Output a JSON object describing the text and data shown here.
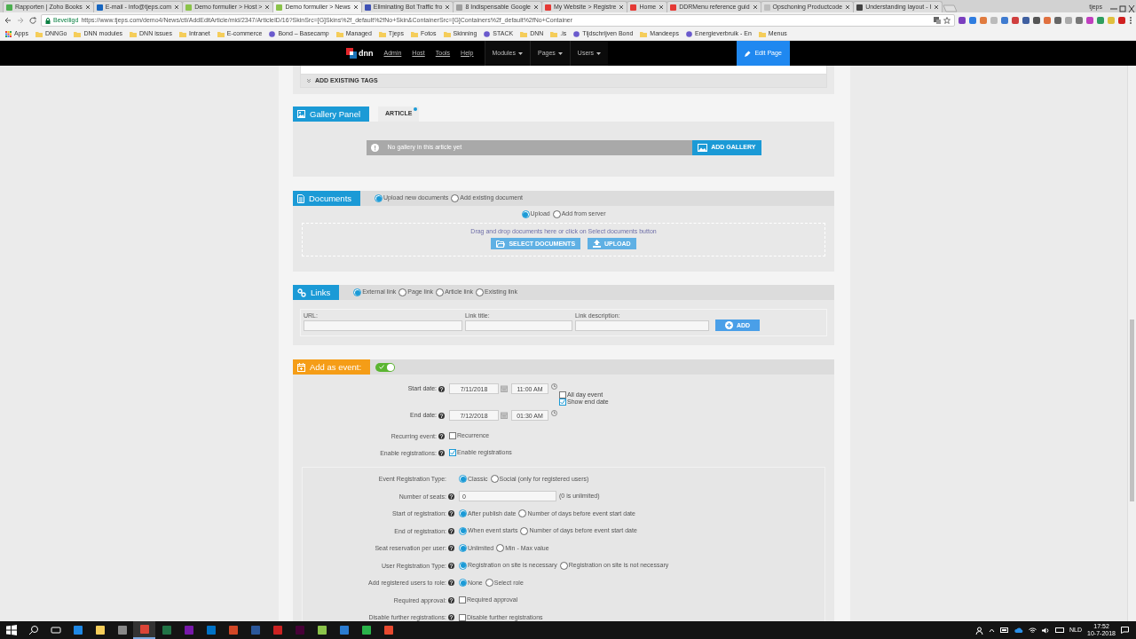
{
  "browser": {
    "tabs": [
      {
        "title": "Rapporten | Zoho Books",
        "selected": false,
        "color": "#4caf50"
      },
      {
        "title": "E-mail - info@tjeps.com",
        "selected": false,
        "color": "#1565c0"
      },
      {
        "title": "Demo formulier > Host >",
        "selected": false,
        "color": "#8bc34a"
      },
      {
        "title": "Demo formulier > News",
        "selected": true,
        "color": "#8bc34a"
      },
      {
        "title": "Eliminating Bot Traffic fro",
        "selected": false,
        "color": "#3f51b5"
      },
      {
        "title": "8 Indispensable Google",
        "selected": false,
        "color": "#9e9e9e"
      },
      {
        "title": "My Website > Registre",
        "selected": false,
        "color": "#e53935"
      },
      {
        "title": "Home",
        "selected": false,
        "color": "#e53935"
      },
      {
        "title": "DDRMenu reference guid",
        "selected": false,
        "color": "#e53935"
      },
      {
        "title": "Opschoning Productcode",
        "selected": false,
        "color": "#bdbdbd"
      },
      {
        "title": "Understanding layout - I",
        "selected": false,
        "color": "#424242"
      }
    ],
    "user": "tjeps",
    "security": "Beveiligd",
    "url": "https://www.tjeps.com/demo4/News/ctl/AddEditArticle/mid/2347/ArticleID/16?SkinSrc=[G]Skins%2f_default%2fNo+Skin&ContainerSrc=[G]Containers%2f_default%2fNo+Container",
    "bookmarks": [
      {
        "label": "Apps",
        "kind": "apps"
      },
      {
        "label": "DNNGo",
        "kind": "folder"
      },
      {
        "label": "DNN modules",
        "kind": "folder"
      },
      {
        "label": "DNN issues",
        "kind": "folder"
      },
      {
        "label": "Intranet",
        "kind": "folder"
      },
      {
        "label": "E-commerce",
        "kind": "folder"
      },
      {
        "label": "Bond – Basecamp",
        "kind": "site"
      },
      {
        "label": "Managed",
        "kind": "folder"
      },
      {
        "label": "Tjeps",
        "kind": "folder"
      },
      {
        "label": "Fotos",
        "kind": "folder"
      },
      {
        "label": "Skinning",
        "kind": "folder"
      },
      {
        "label": "STACK",
        "kind": "site"
      },
      {
        "label": "DNN",
        "kind": "folder"
      },
      {
        "label": ".is",
        "kind": "folder"
      },
      {
        "label": "Tijdschrijven Bond",
        "kind": "site"
      },
      {
        "label": "Mandeeps",
        "kind": "folder"
      },
      {
        "label": "Energieverbruik - En",
        "kind": "site"
      },
      {
        "label": "Menus",
        "kind": "folder"
      }
    ]
  },
  "cms_bar": {
    "logo": "dnn",
    "links": [
      "Admin",
      "Host",
      "Tools",
      "Help"
    ],
    "menus": [
      "Modules",
      "Pages",
      "Users"
    ],
    "edit_button": "Edit Page"
  },
  "tags": {
    "label": "ADD EXISTING TAGS"
  },
  "gallery": {
    "title": "Gallery Panel",
    "tab": "ARTICLE",
    "notice": "No gallery in this article yet",
    "button": "ADD GALLERY"
  },
  "documents": {
    "title": "Documents",
    "sources": [
      {
        "label": "Upload new documents",
        "selected": true
      },
      {
        "label": "Add existing document",
        "selected": false
      }
    ],
    "methods": [
      {
        "label": "Upload",
        "selected": true
      },
      {
        "label": "Add from server",
        "selected": false
      }
    ],
    "drop_hint": "Drag and drop documents here or click on Select documents button",
    "select_button": "SELECT DOCUMENTS",
    "upload_button": "UPLOAD"
  },
  "links": {
    "title": "Links",
    "types": [
      {
        "label": "External link",
        "selected": true
      },
      {
        "label": "Page link",
        "selected": false
      },
      {
        "label": "Article link",
        "selected": false
      },
      {
        "label": "Existing link",
        "selected": false
      }
    ],
    "fields": [
      {
        "label": "URL:"
      },
      {
        "label": "Link title:"
      },
      {
        "label": "Link description:"
      }
    ],
    "button": "ADD"
  },
  "event": {
    "title": "Add as event:",
    "on": true,
    "start": {
      "label": "Start date:",
      "date": "7/11/2018",
      "time": "11:00 AM"
    },
    "end": {
      "label": "End date:",
      "date": "7/12/2018",
      "time": "01:30 AM"
    },
    "all_day": {
      "label": "All day event",
      "checked": false
    },
    "show_end": {
      "label": "Show end date",
      "checked": true
    },
    "rows": [
      {
        "label": "Recurring event:",
        "option": "Recurrence",
        "checked": false
      },
      {
        "label": "Enable registrations:",
        "option": "Enable registrations",
        "checked": true
      }
    ]
  },
  "registration": {
    "rows": [
      {
        "label": "Event Registration Type:",
        "help": false,
        "kind": "radio",
        "options": [
          {
            "label": "Classic",
            "selected": true
          },
          {
            "label": "Social (only for registered users)",
            "selected": false
          }
        ]
      },
      {
        "label": "Number of seats:",
        "help": true,
        "kind": "number",
        "value": "0",
        "note": "(0 is unlimited)"
      },
      {
        "label": "Start of registration:",
        "help": true,
        "kind": "radio",
        "options": [
          {
            "label": "After publish date",
            "selected": true
          },
          {
            "label": "Number of days before event start date",
            "selected": false
          }
        ]
      },
      {
        "label": "End of registration:",
        "help": true,
        "kind": "radio",
        "options": [
          {
            "label": "When event starts",
            "selected": true
          },
          {
            "label": "Number of days before event start date",
            "selected": false
          }
        ]
      },
      {
        "label": "Seat reservation per user:",
        "help": true,
        "kind": "radio",
        "options": [
          {
            "label": "Unlimited",
            "selected": true
          },
          {
            "label": "Min - Max value",
            "selected": false
          }
        ]
      },
      {
        "label": "User Registration Type:",
        "help": true,
        "kind": "radio",
        "options": [
          {
            "label": "Registration on site is necessary",
            "selected": true
          },
          {
            "label": "Registration on site is not necessary",
            "selected": false
          }
        ]
      },
      {
        "label": "Add registered users to role:",
        "help": true,
        "kind": "radio",
        "options": [
          {
            "label": "None",
            "selected": true
          },
          {
            "label": "Select role",
            "selected": false
          }
        ]
      },
      {
        "label": "Required approval:",
        "help": true,
        "kind": "checkbox",
        "option": "Required approval",
        "checked": false
      },
      {
        "label": "Disable further registrations:",
        "help": true,
        "kind": "checkbox",
        "option": "Disable further registrations",
        "checked": false
      }
    ]
  },
  "taskbar": {
    "language": "NLD",
    "time": "17:52",
    "date": "10-7-2018"
  }
}
